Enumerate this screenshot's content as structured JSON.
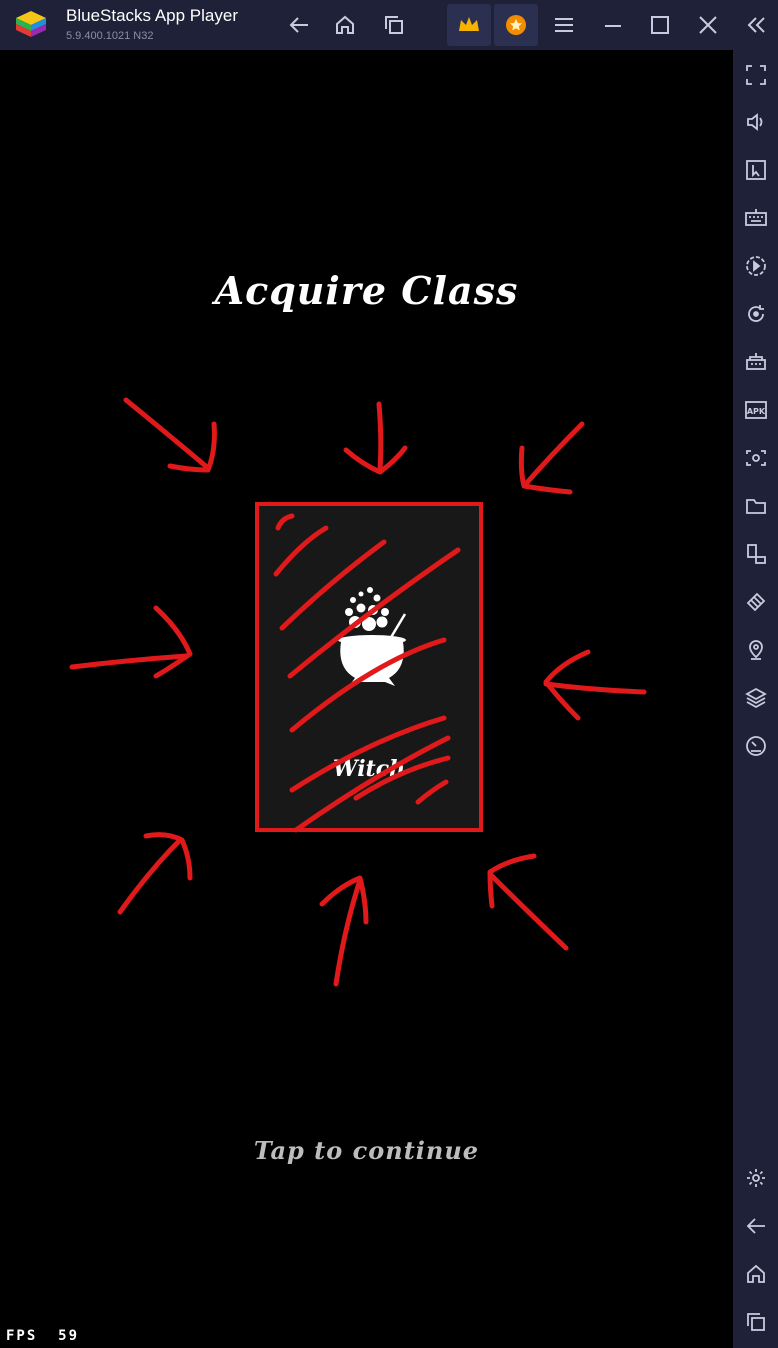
{
  "window": {
    "app_name": "BlueStacks App Player",
    "version": "5.9.400.1021  N32"
  },
  "titlebar_icons": [
    "back-icon",
    "home-icon",
    "recent-apps-icon",
    "crown-icon",
    "points-icon",
    "menu-icon",
    "minimize-icon",
    "maximize-icon",
    "close-icon",
    "collapse-sidebar-icon"
  ],
  "sidebar_icons": [
    "fullscreen-icon",
    "volume-icon",
    "cursor-icon",
    "keyboard-icon",
    "macro-icon",
    "rotate-icon",
    "multi-instance-icon",
    "apk-icon",
    "screenshot-icon",
    "folder-icon",
    "resize-icon",
    "eco-mode-icon",
    "location-icon",
    "layers-icon",
    "speedometer-icon",
    "settings-icon",
    "android-back-icon",
    "android-home-icon",
    "android-recent-icon"
  ],
  "game": {
    "title": "Acquire Class",
    "card": {
      "class_name": "Witch",
      "icon": "cauldron-icon"
    },
    "tap_to_continue": "Tap to continue",
    "fps_label": "FPS",
    "fps_value": "59"
  },
  "colors": {
    "chrome": "#1e2138",
    "annotation_red": "#e0191b",
    "card_border": "#e0191b",
    "text_muted": "#bdbdbd"
  }
}
